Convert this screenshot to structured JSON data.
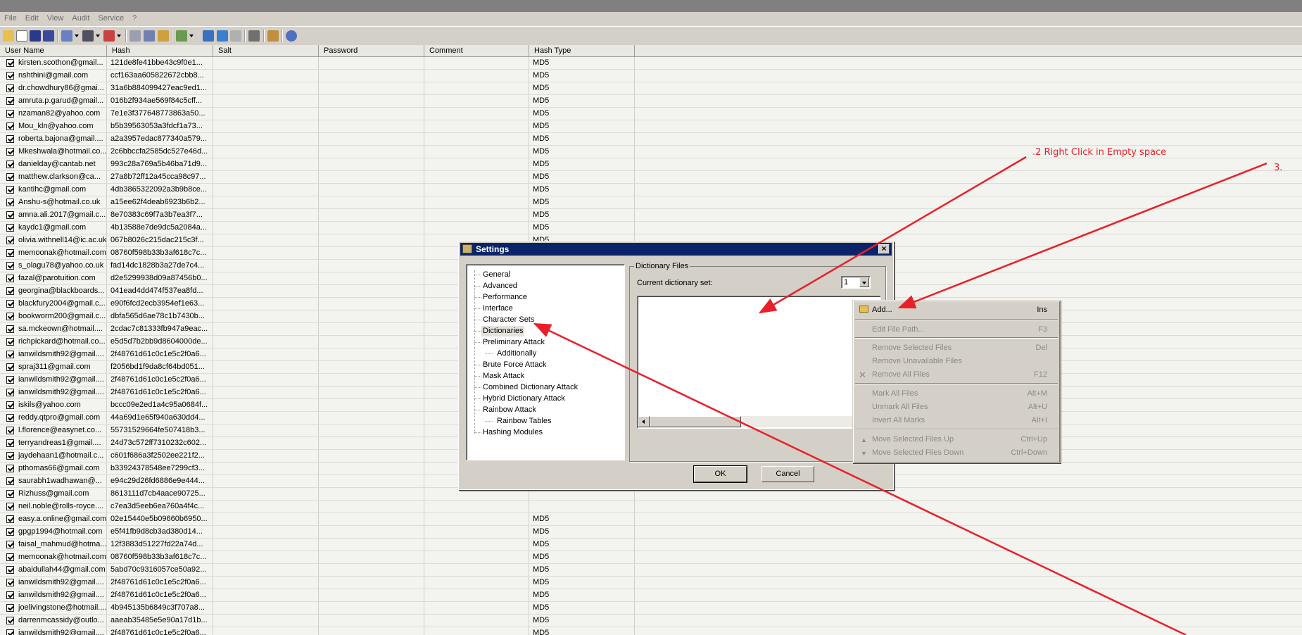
{
  "menu": [
    "File",
    "Edit",
    "View",
    "Audit",
    "Service",
    "?"
  ],
  "toolbar_icons": [
    "open-icon",
    "new-icon",
    "save-icon",
    "save-as-icon",
    "copy-icon",
    "find-icon",
    "delete-icon",
    "edit-icon",
    "import-icon",
    "export-icon",
    "tools-icon",
    "start-icon",
    "step-icon",
    "pause-icon",
    "settings-icon",
    "export-report-icon",
    "help-icon"
  ],
  "columns": [
    "User Name",
    "Hash",
    "Salt",
    "Password",
    "Comment",
    "Hash Type"
  ],
  "rows": [
    [
      "kirsten.scothon@gmail...",
      "121de8fe41bbe43c9f0e1...",
      "MD5"
    ],
    [
      "nshthini@gmail.com",
      "ccf163aa605822672cbb8...",
      "MD5"
    ],
    [
      "dr.chowdhury86@gmai...",
      "31a6b884099427eac9ed1...",
      "MD5"
    ],
    [
      "amruta.p.garud@gmail...",
      "016b2f934ae569f84c5cff...",
      "MD5"
    ],
    [
      "nzaman82@yahoo.com",
      "7e1e3f377648773863a50...",
      "MD5"
    ],
    [
      "Mou_kln@yahoo.com",
      "b5b39563053a3fdcf1a73...",
      "MD5"
    ],
    [
      "roberta.bajona@gmail....",
      "a2a3957edac877340a579...",
      "MD5"
    ],
    [
      "Mkeshwala@hotmail.co...",
      "2c6bbccfa2585dc527e46d...",
      "MD5"
    ],
    [
      "danielday@cantab.net",
      "993c28a769a5b46ba71d9...",
      "MD5"
    ],
    [
      "matthew.clarkson@ca...",
      "27a8b72ff12a45cca98c97...",
      "MD5"
    ],
    [
      "kantihc@gmail.com",
      "4db3865322092a3b9b8ce...",
      "MD5"
    ],
    [
      "Anshu-s@hotmail.co.uk",
      "a15ee62f4deab6923b6b2...",
      "MD5"
    ],
    [
      "amna.ali.2017@gmail.c...",
      "8e70383c69f7a3b7ea3f7...",
      "MD5"
    ],
    [
      "kaydc1@gmail.com",
      "4b13588e7de9dc5a2084a...",
      "MD5"
    ],
    [
      "olivia.withnell14@ic.ac.uk",
      "067b8026c215dac215c3f...",
      "MD5"
    ],
    [
      "memoonak@hotmail.com",
      "08760f598b33b3af618c7c...",
      ""
    ],
    [
      "s_olagu78@yahoo.co.uk",
      "fad14dc1828b3a27de7c4...",
      ""
    ],
    [
      "fazal@parotuition.com",
      "d2e5299938d09a87456b0...",
      ""
    ],
    [
      "georgina@blackboards...",
      "041ead4dd474f537ea8fd...",
      ""
    ],
    [
      "blackfury2004@gmail.c...",
      "e90f6fcd2ecb3954ef1e63...",
      ""
    ],
    [
      "bookworm200@gmail.c...",
      "dbfa565d6ae78c1b7430b...",
      ""
    ],
    [
      "sa.mckeown@hotmail....",
      "2cdac7c81333fb947a9eac...",
      ""
    ],
    [
      "richpickard@hotmail.co...",
      "e5d5d7b2bb9d8604000de...",
      ""
    ],
    [
      "ianwildsmith92@gmail....",
      "2f48761d61c0c1e5c2f0a6...",
      ""
    ],
    [
      "spraj311@gmail.com",
      "f2056bd1f9da8cf64bd051...",
      ""
    ],
    [
      "ianwildsmith92@gmail....",
      "2f48761d61c0c1e5c2f0a6...",
      ""
    ],
    [
      "ianwildsmith92@gmail....",
      "2f48761d61c0c1e5c2f0a6...",
      ""
    ],
    [
      "iskils@yahoo.com",
      "bccc09e2ed1a4c95a0684f...",
      ""
    ],
    [
      "reddy.qtpro@gmail.com",
      "44a69d1e65f940a630dd4...",
      ""
    ],
    [
      "l.florence@easynet.co...",
      "55731529664fe507418b3...",
      ""
    ],
    [
      "terryandreas1@gmail....",
      "24d73c572ff7310232c602...",
      ""
    ],
    [
      "jaydehaan1@hotmail.c...",
      "c601f686a3f2502ee221f2...",
      ""
    ],
    [
      "pthomas66@gmail.com",
      "b33924378548ee7299cf3...",
      ""
    ],
    [
      "saurabh1wadhawan@...",
      "e94c29d26fd6886e9e444...",
      ""
    ],
    [
      "Rizhuss@gmail.com",
      "8613111d7cb4aace90725...",
      ""
    ],
    [
      "neil.noble@rolls-royce....",
      "c7ea3d5eeb6ea760a4f4c...",
      ""
    ],
    [
      "easy.a.online@gmail.com",
      "02e15440e5b09660b6950...",
      "MD5"
    ],
    [
      "gpgp1994@hotmail.com",
      "e5f41fb9d8cb3ad380d14...",
      "MD5"
    ],
    [
      "faisal_mahmud@hotma...",
      "12f3883d51227fd22a74d...",
      "MD5"
    ],
    [
      "memoonak@hotmail.com",
      "08760f598b33b3af618c7c...",
      "MD5"
    ],
    [
      "abaidullah44@gmail.com",
      "5abd70c9316057ce50a92...",
      "MD5"
    ],
    [
      "ianwildsmith92@gmail....",
      "2f48761d61c0c1e5c2f0a6...",
      "MD5"
    ],
    [
      "ianwildsmith92@gmail....",
      "2f48761d61c0c1e5c2f0a6...",
      "MD5"
    ],
    [
      "joelivingstone@hotmail....",
      "4b945135b6849c3f707a8...",
      "MD5"
    ],
    [
      "darrenmcassidy@outlo...",
      "aaeab35485e5e90a17d1b...",
      "MD5"
    ],
    [
      "ianwildsmith92@gmail....",
      "2f48761d61c0c1e5c2f0a6...",
      "MD5"
    ],
    [
      "ianwildsmith92@gmail....",
      "2f48761d61c0c1e5c2f0a6...",
      "MD5"
    ]
  ],
  "dialog": {
    "title": "Settings",
    "tree": [
      "General",
      "Advanced",
      "Performance",
      "Interface",
      "Character Sets",
      "Dictionaries",
      "Preliminary Attack",
      "Additionally",
      "Brute Force Attack",
      "Mask Attack",
      "Combined Dictionary Attack",
      "Hybrid Dictionary Attack",
      "Rainbow Attack",
      "Rainbow Tables",
      "Hashing Modules"
    ],
    "selected": "Dictionaries",
    "group_label": "Dictionary Files",
    "current_set_label": "Current dictionary set:",
    "current_set_value": "1",
    "ok": "OK",
    "cancel": "Cancel"
  },
  "context_menu": [
    {
      "label": "Add...",
      "shortcut": "Ins",
      "enabled": true
    },
    {
      "label": "Edit File Path...",
      "shortcut": "F3",
      "enabled": false
    },
    {
      "label": "Remove Selected Files",
      "shortcut": "Del",
      "enabled": false
    },
    {
      "label": "Remove Unavailable Files",
      "shortcut": "",
      "enabled": false
    },
    {
      "label": "Remove All Files",
      "shortcut": "F12",
      "enabled": false
    },
    {
      "label": "Mark All Files",
      "shortcut": "Alt+M",
      "enabled": false
    },
    {
      "label": "Unmark All Files",
      "shortcut": "Alt+U",
      "enabled": false
    },
    {
      "label": "Invert All Marks",
      "shortcut": "Alt+I",
      "enabled": false
    },
    {
      "label": "Move Selected Files Up",
      "shortcut": "Ctrl+Up",
      "enabled": false
    },
    {
      "label": "Move Selected Files Down",
      "shortcut": "Ctrl+Down",
      "enabled": false
    }
  ],
  "annotations": {
    "step2": ".2 Right Click in Empty space",
    "step3": "3."
  },
  "colors": {
    "annotation": "#e8202a",
    "dialog_title": "#0a246a",
    "window_bg": "#d4d0c8"
  }
}
